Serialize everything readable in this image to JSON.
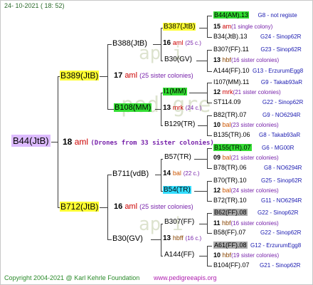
{
  "header": {
    "date": "24- 10-2021 ( 18: 52)"
  },
  "footer": {
    "copyright": "Copyright 2004-2021 @ Karl Kehrle Foundation",
    "url": "www.pedigreeapis.org"
  },
  "watermark": [
    "ap i",
    "ped gre",
    "ap i"
  ],
  "root": {
    "name": "B44(JtB)",
    "colonies_number": "18",
    "breed": "aml",
    "colonies_text": "(Drones from 33 sister colonies)"
  },
  "gen1": [
    {
      "name": "B389(JtB)",
      "num": "17",
      "breed": "aml",
      "colonies": "(25 sister colonies)"
    },
    {
      "name": "B712(JtB)",
      "num": "16",
      "breed": "aml",
      "colonies": "(25 sister colonies)"
    }
  ],
  "gen2": [
    {
      "name": "B388(JtB)"
    },
    {
      "name": "B108(MM)"
    },
    {
      "name": "B711(vdB)"
    },
    {
      "name": "B30(GV)"
    }
  ],
  "gen3": [
    {
      "name": "B387(JtB)",
      "num": "16",
      "breed": "aml",
      "colonies": "(25 c.)"
    },
    {
      "name": "B30(GV)"
    },
    {
      "name": "I1(MM)",
      "num": "13",
      "breed": "mrk",
      "colonies": "(24 c.)"
    },
    {
      "name": "B129(TR)"
    },
    {
      "name": "B57(TR)",
      "num": "14",
      "breed": "bal",
      "colonies": "(22 c.)"
    },
    {
      "name": "B54(TR)"
    },
    {
      "name": "B307(FF)",
      "num": "13",
      "breed": "hbff",
      "colonies": "(16 c.)"
    },
    {
      "name": "A144(FF)"
    }
  ],
  "gen4": [
    {
      "name": "B44(AM).13",
      "note": "G8 - not registe"
    },
    {
      "num": "15",
      "breed": "am",
      "colonies": "(1 single colony)"
    },
    {
      "name": "B34(JtB).13",
      "note": "G24 - Sinop62R"
    },
    {
      "name": "B307(FF).11",
      "note": "G23 - Sinop62R"
    },
    {
      "num": "13",
      "breed": "hbf",
      "colonies": "(16 sister colonies)"
    },
    {
      "name": "A144(FF).10",
      "note": "G13 - ErzurumEgg8"
    },
    {
      "name": "I107(MM).11",
      "note": "G9 - Takab93aR"
    },
    {
      "num": "12",
      "breed": "mrk",
      "colonies": "(21 sister colonies)"
    },
    {
      "name": "ST114.09",
      "note": "G22 - Sinop62R"
    },
    {
      "name": "B82(TR).07",
      "note": "G9 - NO6294R"
    },
    {
      "num": "10",
      "breed": "bal",
      "colonies": "(23 sister colonies)"
    },
    {
      "name": "B135(TR).06",
      "note": "G8 - Takab93aR"
    },
    {
      "name": "B155(TR).07",
      "note": "G6 - MG00R"
    },
    {
      "num": "09",
      "breed": "bal",
      "colonies": "(21 sister colonies)"
    },
    {
      "name": "B78(TR).06",
      "note": "G8 - NO6294R"
    },
    {
      "name": "B70(TR).10",
      "note": "G25 - Sinop62R"
    },
    {
      "num": "12",
      "breed": "bal",
      "colonies": "(24 sister colonies)"
    },
    {
      "name": "B72(TR).10",
      "note": "G11 - NO6294R"
    },
    {
      "name": "B62(FF).08",
      "note": "G22 - Sinop62R"
    },
    {
      "num": "11",
      "breed": "hbf",
      "colonies": "(16 sister colonies)"
    },
    {
      "name": "B58(FF).07",
      "note": "G22 - Sinop62R"
    },
    {
      "name": "A61(FF).08",
      "note": "G12 - ErzurumEgg8"
    },
    {
      "num": "10",
      "breed": "hbf",
      "colonies": "(19 sister colonies)"
    },
    {
      "name": "B104(FF).07",
      "note": "G21 - Sinop62R"
    }
  ]
}
